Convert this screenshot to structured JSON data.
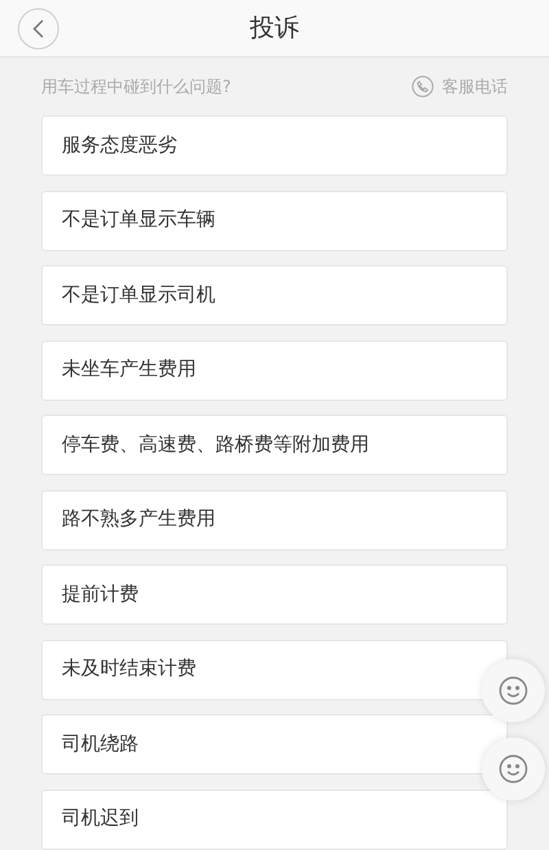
{
  "header": {
    "title": "投诉"
  },
  "prompt": "用车过程中碰到什么问题?",
  "hotline": "客服电话",
  "reasons": [
    "服务态度恶劣",
    "不是订单显示车辆",
    "不是订单显示司机",
    "未坐车产生费用",
    "停车费、高速费、路桥费等附加费用",
    "路不熟多产生费用",
    "提前计费",
    "未及时结束计费",
    "司机绕路",
    "司机迟到"
  ]
}
